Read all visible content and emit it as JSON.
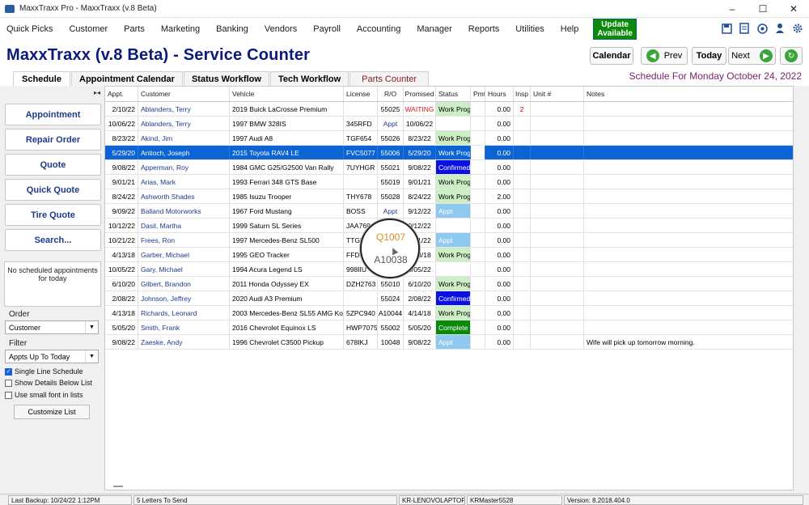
{
  "window": {
    "title": "MaxxTraxx Pro - MaxxTraxx (v.8 Beta)",
    "minimize": "–",
    "maximize": "☐",
    "close": "✕"
  },
  "menu": {
    "items": [
      "Quick Picks",
      "Customer",
      "Parts",
      "Marketing",
      "Banking",
      "Vendors",
      "Payroll",
      "Accounting",
      "Manager",
      "Reports",
      "Utilities",
      "Help"
    ],
    "update_line1": "Update",
    "update_line2": "Available",
    "icons": [
      "save-icon",
      "document-icon",
      "phone-icon",
      "person-icon",
      "gear-icon"
    ]
  },
  "header": {
    "title": "MaxxTraxx (v.8 Beta) - Service Counter",
    "calendar_label": "Calendar",
    "prev_label": "Prev",
    "today_label": "Today",
    "next_label": "Next",
    "schedule_for": "Schedule For Monday October 24, 2022"
  },
  "tabs": [
    "Schedule",
    "Appointment Calendar",
    "Status Workflow",
    "Tech Workflow",
    "Parts Counter"
  ],
  "sidebar": {
    "buttons": [
      "Appointment",
      "Repair Order",
      "Quote",
      "Quick Quote",
      "Tire Quote",
      "Search..."
    ],
    "no_appointments": "No scheduled appointments for today",
    "order_label": "Order",
    "order_value": "Customer",
    "filter_label": "Filter",
    "filter_value": "Appts Up To Today",
    "single_line": "Single Line Schedule",
    "show_details": "Show Details Below List",
    "small_font": "Use small font in lists",
    "customize_label": "Customize List"
  },
  "grid": {
    "columns": [
      "Appt.",
      "Customer",
      "Vehicle",
      "License",
      "R/O",
      "Promised",
      "Status",
      "Pmt",
      "Hours",
      "Insp",
      "Unit #",
      "Notes"
    ],
    "rows": [
      [
        "2/10/22",
        "Ablanders, Terry",
        "2019 Buick  LaCrosse Premium",
        "",
        "55025",
        "WAITING",
        "Work Prog",
        "",
        "0.00",
        "2",
        "",
        ""
      ],
      [
        "10/06/22",
        "Ablanders, Terry",
        "1997 BMW  328IS",
        "345RFD",
        "Appt",
        "10/06/22",
        "",
        "",
        "0.00",
        "",
        "",
        ""
      ],
      [
        "8/23/22",
        "Akind, Jim",
        "1997 Audi  A8",
        "TGF654",
        "55026",
        "8/23/22",
        "Work Prog",
        "",
        "0.00",
        "",
        "",
        ""
      ],
      [
        "5/29/20",
        "Antioch, Joseph",
        "2015 Toyota  RAV4 LE",
        "FVC5077",
        "55006",
        "5/29/20",
        "Work Prog",
        "",
        "0.00",
        "",
        "",
        ""
      ],
      [
        "9/08/22",
        "Apperman, Roy",
        "1984 GMC  G25/G2500 Van Rally",
        "7UYHGR",
        "55021",
        "9/08/22",
        "Confirmed",
        "",
        "0.00",
        "",
        "",
        ""
      ],
      [
        "9/01/21",
        "Arias, Mark",
        "1993 Ferrari  348 GTS Base",
        "",
        "55019",
        "9/01/21",
        "Work Prog",
        "",
        "0.00",
        "",
        "",
        ""
      ],
      [
        "8/24/22",
        "Ashworth Shades",
        "1985 Isuzu  Trooper",
        "THY678",
        "55028",
        "8/24/22",
        "Work Prog",
        "",
        "2.00",
        "",
        "",
        ""
      ],
      [
        "9/09/22",
        "Balland Motorworks",
        "1967 Ford  Mustang",
        "BOSS",
        "Appt",
        "9/12/22",
        "Appt",
        "",
        "0.00",
        "",
        "",
        ""
      ],
      [
        "10/12/22",
        "Dasil, Martha",
        "1999 Saturn  SL Series",
        "JAA769",
        "",
        "0/12/22",
        "",
        "",
        "0.00",
        "",
        "",
        ""
      ],
      [
        "10/21/22",
        "Frees, Ron",
        "1997 Mercedes-Benz  SL500",
        "TTG5",
        "",
        "0/21/22",
        "Appt",
        "",
        "0.00",
        "",
        "",
        ""
      ],
      [
        "4/13/18",
        "Garber, Michael",
        "1995 GEO  Tracker",
        "FFD4",
        "",
        "4/13/18",
        "Work Prog",
        "",
        "0.00",
        "",
        "",
        ""
      ],
      [
        "10/05/22",
        "Gary, Michael",
        "1994 Acura  Legend LS",
        "998IIU",
        "",
        "0/05/22",
        "",
        "",
        "0.00",
        "",
        "",
        ""
      ],
      [
        "6/10/20",
        "Gilbert, Brandon",
        "2011 Honda  Odyssey EX",
        "DZH2763",
        "55010",
        "6/10/20",
        "Work Prog",
        "",
        "0.00",
        "",
        "",
        ""
      ],
      [
        "2/08/22",
        "Johnson, Jeffrey",
        "2020 Audi  A3 Premium",
        "",
        "55024",
        "2/08/22",
        "Confirmed",
        "",
        "0.00",
        "",
        "",
        ""
      ],
      [
        "4/13/18",
        "Richards, Leonard",
        "2003 Mercedes-Benz  SL55 AMG Ko",
        "5ZPC940",
        "A10044",
        "4/14/18",
        "Work Prog",
        "",
        "0.00",
        "",
        "",
        ""
      ],
      [
        "5/05/20",
        "Smith, Frank",
        "2016 Chevrolet  Equinox LS",
        "HWP7075",
        "55002",
        "5/05/20",
        "Complete",
        "",
        "0.00",
        "",
        "",
        ""
      ],
      [
        "9/08/22",
        "Zaeske, Andy",
        "1996 Chevrolet  C3500 Pickup",
        "678IKJ",
        "10048",
        "9/08/22",
        "Appt",
        "",
        "0.00",
        "",
        "",
        "Wife will pick up tomorrow morning."
      ]
    ],
    "selected_row": 3
  },
  "magnifier": {
    "top_text": "Q1007",
    "bottom_text": "A10038"
  },
  "statusbar": {
    "last_backup": "Last Backup: 10/24/22   1:12PM",
    "letters": "5 Letters To Send",
    "computer": "KR-LENOVOLAPTOP",
    "user": "KRMaster5528",
    "version": "Version:  8.2018.404.0"
  },
  "colors": {
    "title_blue": "#0a1a7a",
    "selected_row": "#0b63d4",
    "work_prog": "#cdeec5",
    "confirmed": "#0a10e0",
    "appt": "#8ecaef",
    "complete": "#0a8a0a",
    "waiting": "#d61a1a",
    "update_green": "#0c8a0c"
  }
}
